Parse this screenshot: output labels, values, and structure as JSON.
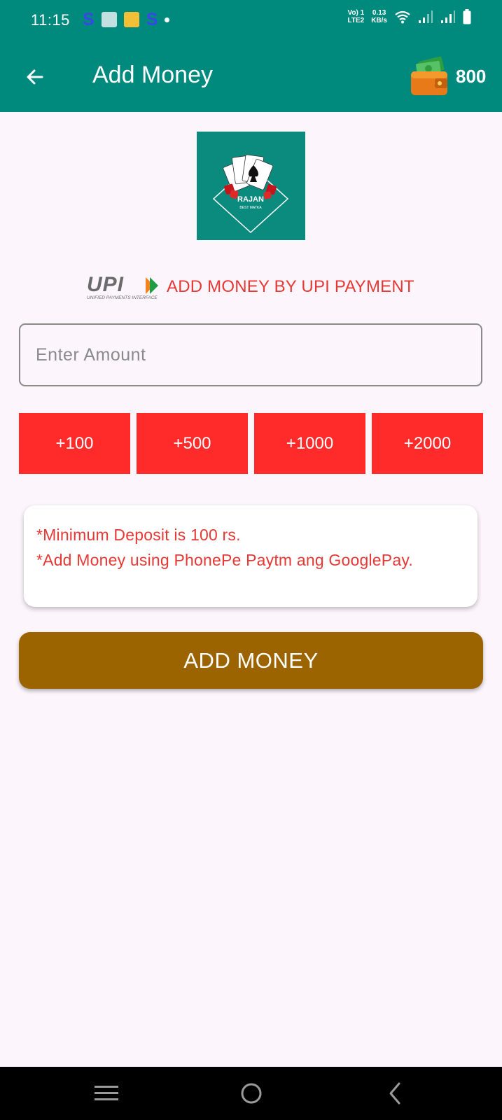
{
  "status_bar": {
    "time": "11:15",
    "notif_s": "S",
    "network_line1": "Vo) 1",
    "network_line2": "LTE2",
    "speed_value": "0.13",
    "speed_unit": "KB/s"
  },
  "header": {
    "title": "Add Money",
    "wallet_balance": "800"
  },
  "logo": {
    "name": "RAJAN",
    "tagline": "BEST MATKA"
  },
  "upi": {
    "logo_text": "UPI",
    "logo_subtext": "UNIFIED PAYMENTS INTERFACE",
    "heading": "ADD MONEY BY UPI PAYMENT"
  },
  "amount_input": {
    "placeholder": "Enter Amount",
    "value": ""
  },
  "quick_amounts": [
    "+100",
    "+500",
    "+1000",
    "+2000"
  ],
  "notes": [
    "*Minimum Deposit is 100 rs.",
    "*Add Money using PhonePe Paytm ang GooglePay."
  ],
  "submit_label": "ADD MONEY",
  "colors": {
    "primary": "#008a7e",
    "accent_red": "#ff2a2a",
    "text_red": "#e53935",
    "button_brown": "#9c6400",
    "background": "#fcf6fc"
  }
}
